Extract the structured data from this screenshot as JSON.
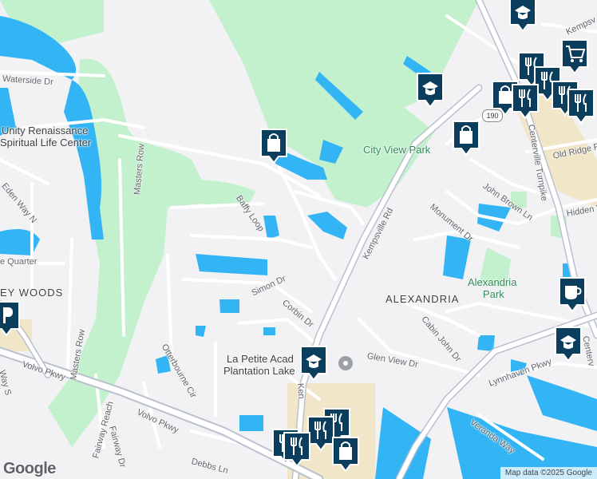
{
  "colors": {
    "water": "#33b5f5",
    "park": "#c3f0cd",
    "road": "#ffffff",
    "highway": "#b9c1cc",
    "pin": "#0b3d5c",
    "commercial": "#f2e6c9"
  },
  "labels": {
    "waterside_dr": "Waterside Dr",
    "unity_line1": "Unity Renaissance",
    "unity_line2": "Spiritual Life Center",
    "eden_way": "Eden Way N",
    "baffy_loop": "Baffy Loop",
    "masters_row_1": "Masters Row",
    "masters_row_2": "Masters Row",
    "quarter": "e Quarter",
    "ey_woods": "EY WOODS",
    "simon_dr": "Simon Dr",
    "corbin_dr": "Corbin Dr",
    "city_view_park": "City View Park",
    "kempsville_rd": "Kempsville Rd",
    "ken": "Ken",
    "monument_dr": "Monument Dr",
    "john_brown_ln": "John Brown Ln",
    "centerville_tpke": "Centerville Turnpike",
    "centerv": "Centerv",
    "old_ridge_rd": "Old Ridge Rd",
    "hidden": "Hidden V",
    "kempsv_top": "Kempsv",
    "alexandria": "ALEXANDRIA",
    "alexandria_park_1": "Alexandria",
    "alexandria_park_2": "Park",
    "cabin_john_dr": "Cabin John Dr",
    "glen_view_dr": "Glen View Dr",
    "lynnhaven_pkwy": "Lynnhaven Pkwy",
    "veranda_way": "Veranda Way",
    "la_petite_1": "La Petite Acad",
    "la_petite_2": "Plantation Lake",
    "otterbourne_cir": "Otterbourne Cir",
    "volvo_pkwy_1": "Volvo Pkwy",
    "volvo_pkwy_2": "Volvo Pkwy",
    "fairway_reach": "Fairway Reach",
    "fairway_dr": "Fairway Dr",
    "debbs_ln": "Debbs Ln",
    "way_s": "Way S"
  },
  "route_badge": "190",
  "logo": "Google",
  "attribution": "Map data ©2025 Google",
  "markers": [
    {
      "icon": "graduation-cap"
    },
    {
      "icon": "shopping-cart"
    },
    {
      "icon": "graduation-cap"
    },
    {
      "icon": "restaurant"
    },
    {
      "icon": "shopping-bag"
    },
    {
      "icon": "restaurant"
    },
    {
      "icon": "restaurant"
    },
    {
      "icon": "shopping-bag"
    },
    {
      "icon": "shopping-bag"
    },
    {
      "icon": "coffee"
    },
    {
      "icon": "graduation-cap"
    },
    {
      "icon": "graduation-cap"
    },
    {
      "icon": "restaurant"
    },
    {
      "icon": "restaurant"
    },
    {
      "icon": "shopping-bag"
    }
  ]
}
